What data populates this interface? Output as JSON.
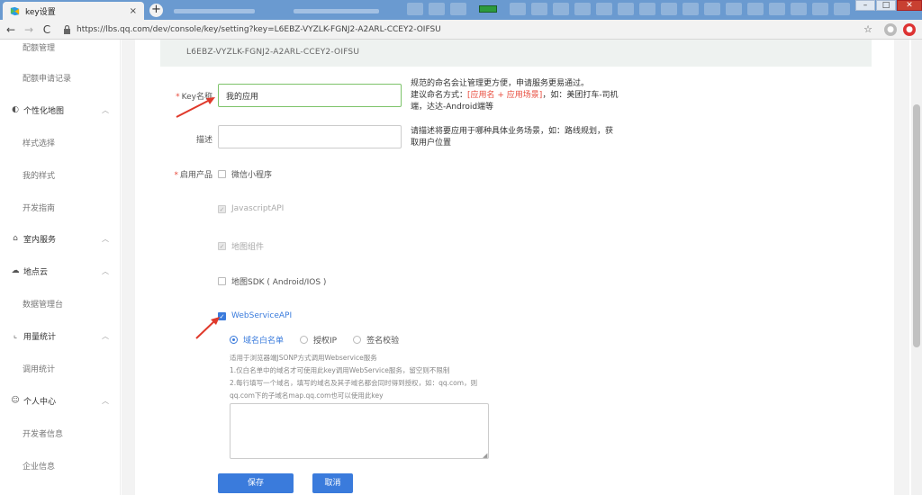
{
  "browser": {
    "tabs": [
      {
        "title": "key设置",
        "active": true
      },
      {
        "title": "",
        "active": false
      },
      {
        "title": "",
        "active": false
      }
    ],
    "url": "https://lbs.qq.com/dev/console/key/setting?key=L6EBZ-VYZLK-FGNJ2-A2ARL-CCEY2-OIFSU",
    "controls": {
      "back": "←",
      "forward": "→",
      "reload": "C",
      "close": "×",
      "new_tab": "+",
      "minimize": "–",
      "maximize": "□",
      "win_close": "✕",
      "star": "☆"
    }
  },
  "sidebar": {
    "items": [
      {
        "label": "配额管理",
        "type": "sub"
      },
      {
        "label": "配额申请记录",
        "type": "sub"
      },
      {
        "label": "个性化地图",
        "type": "head",
        "icon": "palette-icon"
      },
      {
        "label": "样式选择",
        "type": "sub"
      },
      {
        "label": "我的样式",
        "type": "sub"
      },
      {
        "label": "开发指南",
        "type": "sub"
      },
      {
        "label": "室内服务",
        "type": "head",
        "icon": "home-icon"
      },
      {
        "label": "地点云",
        "type": "head",
        "icon": "cloud-icon"
      },
      {
        "label": "数据管理台",
        "type": "sub"
      },
      {
        "label": "用量统计",
        "type": "head",
        "icon": "chart-icon"
      },
      {
        "label": "调用统计",
        "type": "sub"
      },
      {
        "label": "个人中心",
        "type": "head",
        "icon": "user-icon"
      },
      {
        "label": "开发者信息",
        "type": "sub"
      },
      {
        "label": "企业信息",
        "type": "sub"
      }
    ]
  },
  "key": {
    "value": "L6EBZ-VYZLK-FGNJ2-A2ARL-CCEY2-OIFSU"
  },
  "form": {
    "name_label": "Key名称",
    "name_value": "我的应用",
    "name_hint_1": "规范的命名会让管理更方便，申请服务更易通过。",
    "name_hint_2_pre": "建议命名方式：",
    "name_hint_2_red": "[应用名 + 应用场景]",
    "name_hint_2_post": "，如：美团打车-司机",
    "name_hint_3": "端，达达-Android端等",
    "desc_label": "描述",
    "desc_value": "",
    "desc_hint_1": "请描述将要应用于哪种具体业务场景，如：路线规划，获",
    "desc_hint_2": "取用户位置",
    "product_label": "启用产品",
    "products": [
      {
        "label": "微信小程序",
        "checked": false,
        "disabled": false
      },
      {
        "label": "JavascriptAPI",
        "checked": true,
        "disabled": true
      },
      {
        "label": "地图组件",
        "checked": true,
        "disabled": true
      },
      {
        "label": "地图SDK ( Android/IOS )",
        "checked": false,
        "disabled": false
      },
      {
        "label": "WebServiceAPI",
        "checked": true,
        "disabled": false
      }
    ],
    "radios": [
      {
        "label": "域名白名单",
        "selected": true
      },
      {
        "label": "授权IP",
        "selected": false
      },
      {
        "label": "签名校验",
        "selected": false
      }
    ],
    "notes": [
      "适用于浏览器端JSONP方式调用Webservice服务",
      "1.仅白名单中的域名才可使用此key调用WebService服务，留空则不限制",
      "2.每行填写一个域名，填写的域名及其子域名都会同时得到授权，如：qq.com，则",
      "qq.com下的子域名map.qq.com也可以使用此key"
    ],
    "whitelist_value": "",
    "save_label": "保存",
    "cancel_label": "取消"
  },
  "colors": {
    "primary": "#3a7bdc",
    "required": "#e84b3c",
    "focus_border": "#7dc36a",
    "arrow": "#e0392b"
  }
}
